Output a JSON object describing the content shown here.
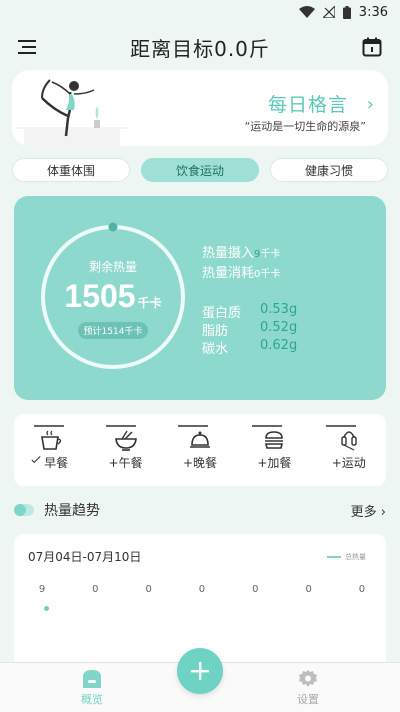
{
  "status_bar": {
    "time": "3:36"
  },
  "header": {
    "title": "距离目标0.0斤"
  },
  "banner": {
    "title": "每日格言",
    "quote": "“运动是一切生命的源泉”"
  },
  "tabs": [
    {
      "label": "体重体围",
      "active": false
    },
    {
      "label": "饮食运动",
      "active": true
    },
    {
      "label": "健康习惯",
      "active": false
    }
  ],
  "calorie": {
    "label": "剩余热量",
    "value": "1505",
    "unit": "千卡",
    "planned": "预计1514千卡",
    "intake_label": "热量摄入",
    "intake_value": "9",
    "intake_unit": "千卡",
    "burn_label": "热量消耗",
    "burn_value": "0",
    "burn_unit": "千卡",
    "macros": [
      {
        "label": "蛋白质",
        "value": "0.53g"
      },
      {
        "label": "脂肪",
        "value": "0.52g"
      },
      {
        "label": "碳水",
        "value": "0.62g"
      }
    ]
  },
  "meals": [
    {
      "label": "早餐",
      "icon": "coffee-cup-icon",
      "done": true
    },
    {
      "label": "+午餐",
      "icon": "noodle-bowl-icon",
      "done": false
    },
    {
      "label": "+晚餐",
      "icon": "dinner-cloche-icon",
      "done": false
    },
    {
      "label": "+加餐",
      "icon": "burger-icon",
      "done": false
    },
    {
      "label": "+运动",
      "icon": "jump-rope-icon",
      "done": false
    }
  ],
  "trend": {
    "title": "热量趋势",
    "more": "更多",
    "date_range": "07月04日-07月10日",
    "legend": "总热量",
    "values": [
      "9",
      "0",
      "0",
      "0",
      "0",
      "0",
      "0"
    ]
  },
  "bottom_nav": {
    "overview": "概览",
    "settings": "设置"
  },
  "colors": {
    "accent": "#6fd3c4",
    "card": "#8ed9ce",
    "highlight": "#2da594",
    "background": "#eef6f4"
  }
}
